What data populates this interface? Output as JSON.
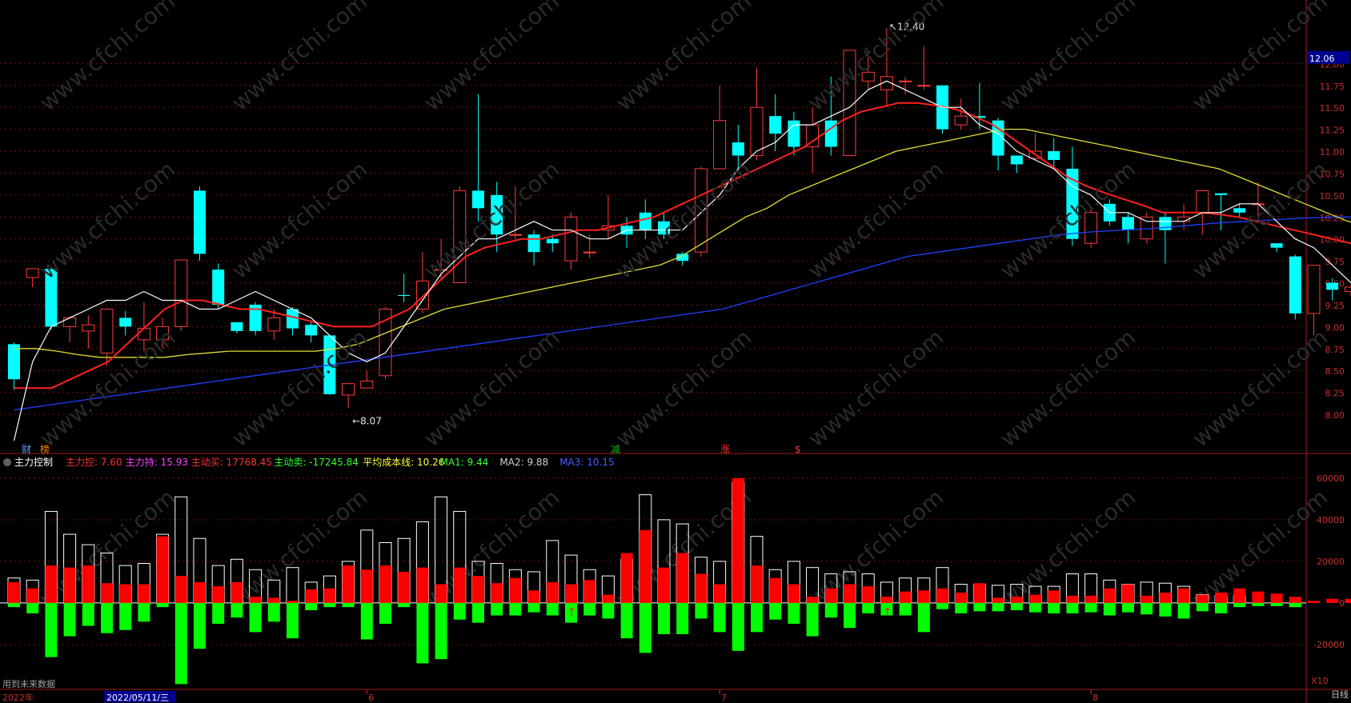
{
  "theme": {
    "background": "#000000",
    "up_color": "#ff3b3b",
    "down_color": "#00ffff",
    "grid_color": "#7a1010",
    "ma_colors": {
      "ma5": "#ffffff",
      "ma10": "#ff2020",
      "ma20": "#e0e030",
      "ma60": "#2040ff"
    },
    "buy_color": "#ff0000",
    "sell_color": "#00ff00",
    "axis_text": "#c83030"
  },
  "markers": {
    "high_label": "12.40",
    "low_label": "8.07",
    "price_tag": "12.06"
  },
  "flags": [
    {
      "label": "财",
      "color": "#5aa0ff"
    },
    {
      "label": "榜",
      "color": "#ff8800"
    },
    {
      "label": "减",
      "color": "#00c000"
    },
    {
      "label": "涨",
      "color": "#ff3030"
    },
    {
      "label": "$",
      "color": "#ff3030"
    }
  ],
  "indicator": {
    "title": "主力控制",
    "items": [
      {
        "label": "主力控: 7.60",
        "color": "#ff3030"
      },
      {
        "label": "主力持: 15.93",
        "color": "#ff40ff"
      },
      {
        "label": "主动买: 17768.45",
        "color": "#ff3030"
      },
      {
        "label": "主动卖: -17245.84",
        "color": "#30ff30"
      },
      {
        "label": "平均成本线: 10.26",
        "color": "#ffff40"
      },
      {
        "label": "MA1: 9.44",
        "color": "#30ff30"
      },
      {
        "label": "MA2: 9.88",
        "color": "#d0d0d0"
      },
      {
        "label": "MA3: 10.15",
        "color": "#4060ff"
      }
    ],
    "multiplier": "X10"
  },
  "footer": {
    "note": "用到未来数据",
    "year": "2022年",
    "cursor_date": "2022/05/11/三",
    "months": [
      "6",
      "7",
      "8"
    ],
    "period": "日线"
  },
  "watermark": "www.cfchi.com",
  "chart_data": [
    {
      "type": "candlestick",
      "y_ticks": [
        "12.00",
        "11.75",
        "11.50",
        "11.25",
        "11.00",
        "10.75",
        "10.50",
        "10.25",
        "10.00",
        "9.75",
        "9.50",
        "9.25",
        "9.00",
        "8.75",
        "8.50",
        "8.25",
        "8.00"
      ],
      "ylim": [
        7.8,
        12.45
      ],
      "grid": true,
      "candles": [
        [
          8.8,
          8.4,
          8.82,
          8.28
        ],
        [
          9.56,
          9.66,
          9.66,
          9.45
        ],
        [
          9.66,
          9.0,
          9.66,
          8.96
        ],
        [
          9.0,
          9.1,
          9.12,
          8.82
        ],
        [
          8.95,
          9.02,
          9.13,
          8.75
        ],
        [
          8.7,
          9.2,
          9.2,
          8.55
        ],
        [
          9.1,
          9.0,
          9.18,
          8.9
        ],
        [
          8.85,
          8.98,
          9.28,
          8.72
        ],
        [
          8.85,
          9.0,
          9.1,
          8.75
        ],
        [
          9.0,
          9.76,
          9.76,
          8.95
        ],
        [
          10.55,
          9.83,
          10.6,
          9.75
        ],
        [
          9.65,
          9.25,
          9.72,
          9.2
        ],
        [
          9.05,
          8.95,
          9.05,
          8.92
        ],
        [
          9.25,
          8.95,
          9.28,
          8.9
        ],
        [
          8.95,
          9.1,
          9.2,
          8.85
        ],
        [
          9.2,
          8.98,
          9.22,
          8.9
        ],
        [
          9.02,
          8.9,
          9.05,
          8.82
        ],
        [
          8.9,
          8.23,
          8.9,
          8.22
        ],
        [
          8.22,
          8.35,
          8.35,
          8.07
        ],
        [
          8.3,
          8.38,
          8.5,
          8.3
        ],
        [
          8.44,
          9.2,
          9.22,
          8.4
        ],
        [
          9.36,
          9.35,
          9.6,
          9.28
        ],
        [
          9.2,
          9.52,
          9.85,
          9.15
        ],
        [
          9.65,
          9.65,
          10.0,
          9.55
        ],
        [
          9.5,
          10.55,
          10.6,
          9.5
        ],
        [
          10.55,
          10.35,
          11.65,
          10.2
        ],
        [
          10.5,
          10.05,
          10.65,
          9.85
        ],
        [
          10.05,
          10.05,
          10.6,
          10.0
        ],
        [
          10.05,
          9.85,
          10.1,
          9.7
        ],
        [
          10.0,
          9.95,
          10.05,
          9.85
        ],
        [
          9.75,
          10.25,
          10.3,
          9.65
        ],
        [
          9.85,
          9.85,
          10.05,
          9.78
        ],
        [
          10.1,
          10.15,
          10.5,
          10.0
        ],
        [
          10.15,
          10.05,
          10.25,
          9.9
        ],
        [
          10.3,
          10.1,
          10.45,
          10.0
        ],
        [
          10.2,
          10.05,
          10.3,
          10.0
        ],
        [
          9.83,
          9.75,
          9.85,
          9.7
        ],
        [
          9.85,
          10.8,
          10.82,
          9.8
        ],
        [
          10.8,
          11.35,
          11.75,
          10.8
        ],
        [
          11.1,
          10.95,
          11.3,
          10.8
        ],
        [
          10.95,
          11.5,
          11.95,
          10.9
        ],
        [
          11.4,
          11.2,
          11.65,
          11.0
        ],
        [
          11.35,
          11.05,
          11.45,
          10.95
        ],
        [
          11.05,
          11.3,
          11.5,
          10.75
        ],
        [
          11.35,
          11.05,
          11.85,
          10.95
        ],
        [
          10.95,
          12.15,
          12.15,
          10.95
        ],
        [
          11.8,
          11.9,
          12.15,
          11.7
        ],
        [
          11.7,
          11.85,
          12.4,
          11.5
        ],
        [
          11.8,
          11.8,
          11.85,
          11.65
        ],
        [
          11.75,
          11.75,
          12.2,
          11.7
        ],
        [
          11.75,
          11.25,
          11.75,
          11.2
        ],
        [
          11.3,
          11.4,
          11.6,
          11.25
        ],
        [
          11.4,
          11.38,
          11.78,
          11.25
        ],
        [
          11.35,
          10.95,
          11.38,
          10.78
        ],
        [
          10.95,
          10.85,
          10.95,
          10.75
        ],
        [
          10.92,
          11.0,
          11.2,
          10.9
        ],
        [
          11.0,
          10.9,
          11.15,
          10.8
        ],
        [
          10.8,
          10.0,
          11.05,
          9.92
        ],
        [
          9.95,
          10.3,
          10.35,
          9.9
        ],
        [
          10.4,
          10.2,
          10.45,
          10.15
        ],
        [
          10.25,
          10.1,
          10.3,
          9.95
        ],
        [
          10.0,
          10.25,
          10.3,
          9.95
        ],
        [
          10.25,
          10.1,
          10.3,
          9.72
        ],
        [
          10.2,
          10.25,
          10.4,
          10.1
        ],
        [
          10.3,
          10.55,
          10.55,
          10.05
        ],
        [
          10.52,
          10.5,
          10.52,
          10.1
        ],
        [
          10.35,
          10.3,
          10.4,
          10.25
        ],
        [
          10.4,
          10.4,
          10.65,
          10.2
        ],
        [
          9.95,
          9.9,
          9.95,
          9.85
        ],
        [
          9.8,
          9.15,
          9.82,
          9.08
        ],
        [
          9.15,
          9.7,
          9.7,
          8.9
        ],
        [
          9.5,
          9.42,
          9.55,
          9.3
        ],
        [
          9.4,
          9.45,
          9.48,
          9.35
        ],
        [
          9.45,
          9.47,
          9.75,
          9.42
        ]
      ],
      "ma5": [
        7.7,
        8.6,
        9.0,
        9.1,
        9.2,
        9.3,
        9.3,
        9.4,
        9.3,
        9.3,
        9.2,
        9.2,
        9.3,
        9.4,
        9.3,
        9.2,
        9.1,
        8.9,
        8.7,
        8.6,
        8.7,
        9.0,
        9.3,
        9.6,
        9.8,
        10.0,
        10.0,
        10.1,
        10.2,
        10.1,
        10.1,
        10.0,
        10.0,
        10.1,
        10.1,
        10.1,
        10.1,
        10.3,
        10.5,
        10.8,
        11.0,
        11.1,
        11.3,
        11.3,
        11.4,
        11.5,
        11.7,
        11.8,
        11.7,
        11.6,
        11.5,
        11.5,
        11.3,
        11.2,
        11.0,
        10.9,
        10.8,
        10.6,
        10.5,
        10.3,
        10.3,
        10.2,
        10.2,
        10.2,
        10.3,
        10.3,
        10.4,
        10.4,
        10.2,
        10.0,
        9.9,
        9.7,
        9.5,
        9.4
      ],
      "ma10": [
        8.3,
        8.3,
        8.3,
        8.4,
        8.5,
        8.6,
        8.8,
        9.0,
        9.2,
        9.3,
        9.3,
        9.25,
        9.2,
        9.2,
        9.15,
        9.1,
        9.05,
        9.0,
        9.0,
        9.0,
        9.1,
        9.2,
        9.4,
        9.6,
        9.8,
        9.9,
        9.95,
        10.0,
        10.0,
        10.05,
        10.1,
        10.1,
        10.15,
        10.2,
        10.25,
        10.35,
        10.45,
        10.55,
        10.65,
        10.75,
        10.85,
        10.95,
        11.05,
        11.2,
        11.35,
        11.45,
        11.5,
        11.55,
        11.55,
        11.52,
        11.48,
        11.4,
        11.3,
        11.15,
        11.0,
        10.85,
        10.7,
        10.6,
        10.52,
        10.45,
        10.38,
        10.3,
        10.3,
        10.3,
        10.28,
        10.25,
        10.2,
        10.15,
        10.1,
        10.05,
        10.0,
        9.95,
        9.9
      ],
      "ma20": [
        8.75,
        8.75,
        8.72,
        8.68,
        8.65,
        8.65,
        8.65,
        8.65,
        8.68,
        8.7,
        8.72,
        8.72,
        8.72,
        8.72,
        8.72,
        8.75,
        8.8,
        8.9,
        9.0,
        9.1,
        9.2,
        9.25,
        9.3,
        9.35,
        9.4,
        9.45,
        9.5,
        9.55,
        9.6,
        9.65,
        9.7,
        9.8,
        9.95,
        10.1,
        10.25,
        10.35,
        10.5,
        10.6,
        10.7,
        10.8,
        10.9,
        11.0,
        11.05,
        11.1,
        11.15,
        11.2,
        11.25,
        11.25,
        11.2,
        11.15,
        11.1,
        11.05,
        11.0,
        10.95,
        10.9,
        10.85,
        10.8,
        10.7,
        10.6,
        10.5,
        10.4,
        10.3,
        10.2,
        10.15
      ],
      "ma60": [
        8.05,
        8.1,
        8.15,
        8.2,
        8.25,
        8.3,
        8.35,
        8.4,
        8.45,
        8.5,
        8.55,
        8.6,
        8.65,
        8.7,
        8.75,
        8.8,
        8.85,
        8.9,
        8.95,
        9.0,
        9.05,
        9.1,
        9.15,
        9.2,
        9.3,
        9.4,
        9.5,
        9.6,
        9.7,
        9.8,
        9.85,
        9.9,
        9.95,
        10.0,
        10.05,
        10.08,
        10.1,
        10.12,
        10.15,
        10.18,
        10.2,
        10.22,
        10.24,
        10.25,
        10.25
      ],
      "signal": {
        "label": "↑",
        "color": "#ff2020"
      }
    },
    {
      "type": "bar",
      "title": "主力控制",
      "y_ticks": [
        "60000",
        "40000",
        "20000",
        "0",
        "-20000"
      ],
      "ylim": [
        -40000,
        63000
      ],
      "grid": true,
      "series": [
        {
          "name": "主动买",
          "values": [
            10000,
            7000,
            18000,
            17000,
            18000,
            9500,
            9000,
            9000,
            32000,
            13000,
            10000,
            8000,
            10000,
            3000,
            2500,
            1000,
            6500,
            7000,
            18000,
            16000,
            18000,
            15000,
            17000,
            9000,
            17000,
            13000,
            9500,
            12000,
            6000,
            10000,
            9000,
            11000,
            4000,
            24000,
            35000,
            17000,
            24000,
            14000,
            9000,
            60000,
            18000,
            12000,
            9000,
            3000,
            7000,
            9000,
            8000,
            3000,
            5500,
            6000,
            7000,
            5000,
            9500,
            2500,
            3000,
            4000,
            6000,
            3500,
            3500,
            7000,
            9000,
            3500,
            5000,
            7000,
            4000,
            5000,
            7000,
            5500,
            4500,
            3000,
            1000,
            2000,
            2000
          ]
        },
        {
          "name": "主动卖",
          "values": [
            -2000,
            -5000,
            -26000,
            -16000,
            -11000,
            -14500,
            -13000,
            -9000,
            -2000,
            -39000,
            -22000,
            -10000,
            -7000,
            -14000,
            -9000,
            -17000,
            -3500,
            -2000,
            -2000,
            -17500,
            -10000,
            -2000,
            -29000,
            -27000,
            -8000,
            -9500,
            -6000,
            -6000,
            -4500,
            -6000,
            -9500,
            -6000,
            -7500,
            -17000,
            -24000,
            -15000,
            -15000,
            -7500,
            -14000,
            -23000,
            -14000,
            -8000,
            -10000,
            -16000,
            -7000,
            -12000,
            -5000,
            -6000,
            -6000,
            -14000,
            -3000,
            -5000,
            -4000,
            -4000,
            -3500,
            -4500,
            -5000,
            -5000,
            -4500,
            -6000,
            -4500,
            -5500,
            -6500,
            -7500,
            -4000,
            -5000,
            -2000,
            -1500,
            -1500,
            -2000
          ]
        },
        {
          "name": "总量",
          "values": [
            12000,
            11000,
            44000,
            33000,
            28000,
            24000,
            18000,
            19000,
            33000,
            51000,
            31000,
            18000,
            21000,
            16000,
            11000,
            17000,
            10000,
            13000,
            20000,
            35000,
            29000,
            31000,
            39000,
            51000,
            44000,
            20000,
            19000,
            16000,
            15000,
            30000,
            23000,
            16000,
            13000,
            21000,
            52000,
            40000,
            38000,
            22000,
            20000,
            58000,
            32000,
            16000,
            20000,
            17000,
            14000,
            15000,
            14000,
            10000,
            12000,
            12000,
            17000,
            9000,
            9000,
            8500,
            9000,
            8000,
            8000,
            14000,
            14000,
            11000,
            9000,
            10000,
            9500,
            8000,
            4000,
            3500,
            3500
          ]
        }
      ]
    }
  ]
}
